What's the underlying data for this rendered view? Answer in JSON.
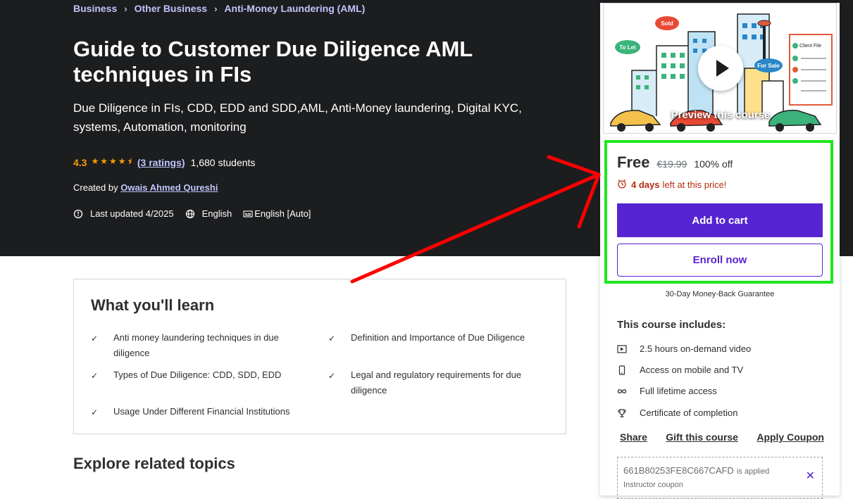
{
  "breadcrumb": [
    "Business",
    "Other Business",
    "Anti-Money Laundering (AML)"
  ],
  "course": {
    "title": "Guide to Customer Due Diligence AML techniques in FIs",
    "subtitle": "Due Diligence in FIs, CDD, EDD and SDD,AML, Anti-Money laundering, Digital KYC, systems, Automation, monitoring",
    "rating": "4.3",
    "stars_value": 4.3,
    "ratings_link": "(3 ratings)",
    "students": "1,680 students",
    "created_by_label": "Created by",
    "author": "Owais Ahmed Qureshi",
    "last_updated": "Last updated 4/2025",
    "language": "English",
    "captions": "English [Auto]"
  },
  "learn": {
    "title": "What you'll learn",
    "items": [
      "Anti money laundering techniques in due diligence",
      "Definition and Importance of Due Diligence",
      "Types of Due Diligence: CDD, SDD, EDD",
      "Legal and regulatory requirements for due diligence",
      "Usage Under Different Financial Institutions"
    ]
  },
  "explore_title": "Explore related topics",
  "sidebar": {
    "preview_label": "Preview this course",
    "preview_signs": [
      "Sold",
      "To Let",
      "For Sale",
      "Client File"
    ],
    "price": "Free",
    "old_price": "€19.99",
    "discount": "100% off",
    "timer_days": "4 days",
    "timer_rest": "left at this price!",
    "add_to_cart": "Add to cart",
    "enroll_now": "Enroll now",
    "guarantee": "30-Day Money-Back Guarantee",
    "includes_title": "This course includes:",
    "includes": [
      {
        "icon": "video-icon",
        "label": "2.5 hours on-demand video"
      },
      {
        "icon": "mobile-icon",
        "label": "Access on mobile and TV"
      },
      {
        "icon": "infinity-icon",
        "label": "Full lifetime access"
      },
      {
        "icon": "trophy-icon",
        "label": "Certificate of completion"
      }
    ],
    "share": "Share",
    "gift": "Gift this course",
    "apply_coupon": "Apply Coupon",
    "coupon_code": "661B80253FE8C667CAFD",
    "coupon_applied": "is applied",
    "coupon_note": "Instructor coupon"
  },
  "colors": {
    "brand_purple": "#5624d0",
    "hero_bg": "#1c1d1f",
    "star_orange": "#f69c08",
    "highlight_green": "#1ee61e",
    "annotation_red": "#ff0000",
    "timer_red": "#b32d0f"
  }
}
